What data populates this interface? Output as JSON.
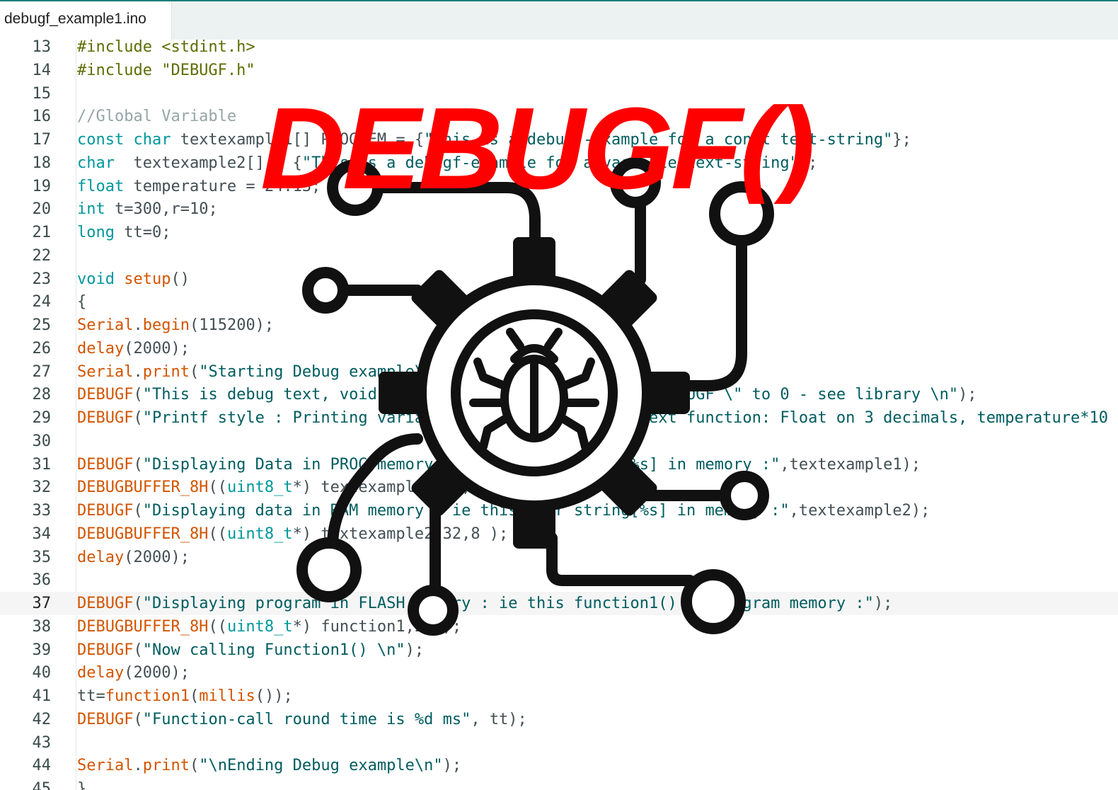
{
  "tab": {
    "filename": "debugf_example1.ino"
  },
  "editor": {
    "current_line": "37",
    "lines": [
      {
        "num": "13",
        "tokens": [
          {
            "t": "#include <stdint.h>",
            "c": "t-pre"
          }
        ]
      },
      {
        "num": "14",
        "tokens": [
          {
            "t": "#include \"DEBUGF.h\"",
            "c": "t-pre"
          }
        ]
      },
      {
        "num": "15",
        "tokens": []
      },
      {
        "num": "16",
        "tokens": [
          {
            "t": "//Global Variable",
            "c": "t-com"
          }
        ]
      },
      {
        "num": "17",
        "tokens": [
          {
            "t": "const char",
            "c": "t-kw"
          },
          {
            "t": " textexample1[] PROGMEM = {",
            "c": "t-p"
          },
          {
            "t": "\"This is a debugf-example for a const text-string\"",
            "c": "t-str"
          },
          {
            "t": "};",
            "c": "t-p"
          }
        ]
      },
      {
        "num": "18",
        "tokens": [
          {
            "t": "char",
            "c": "t-kw"
          },
          {
            "t": "  textexample2[] = {",
            "c": "t-p"
          },
          {
            "t": "\"This is a debugf-example for a variable text-string\"",
            "c": "t-str"
          },
          {
            "t": "};",
            "c": "t-p"
          }
        ]
      },
      {
        "num": "19",
        "tokens": [
          {
            "t": "float",
            "c": "t-kw"
          },
          {
            "t": " temperature = 24.13;",
            "c": "t-p"
          }
        ]
      },
      {
        "num": "20",
        "tokens": [
          {
            "t": "int",
            "c": "t-kw"
          },
          {
            "t": " t=300,r=10;",
            "c": "t-p"
          }
        ]
      },
      {
        "num": "21",
        "tokens": [
          {
            "t": "long",
            "c": "t-kw"
          },
          {
            "t": " tt=0;",
            "c": "t-p"
          }
        ]
      },
      {
        "num": "22",
        "tokens": []
      },
      {
        "num": "23",
        "tokens": [
          {
            "t": "void",
            "c": "t-kw"
          },
          {
            "t": " ",
            "c": "t-p"
          },
          {
            "t": "setup",
            "c": "t-fn"
          },
          {
            "t": "()",
            "c": "t-p"
          }
        ]
      },
      {
        "num": "24",
        "tokens": [
          {
            "t": "{",
            "c": "t-p"
          }
        ]
      },
      {
        "num": "25",
        "tokens": [
          {
            "t": "Serial",
            "c": "t-fn"
          },
          {
            "t": ".",
            "c": "t-p"
          },
          {
            "t": "begin",
            "c": "t-fn"
          },
          {
            "t": "(115200);",
            "c": "t-p"
          }
        ]
      },
      {
        "num": "26",
        "tokens": [
          {
            "t": "delay",
            "c": "t-fn"
          },
          {
            "t": "(2000);",
            "c": "t-p"
          }
        ]
      },
      {
        "num": "27",
        "tokens": [
          {
            "t": "Serial",
            "c": "t-fn"
          },
          {
            "t": ".",
            "c": "t-p"
          },
          {
            "t": "print",
            "c": "t-fn"
          },
          {
            "t": "(",
            "c": "t-p"
          },
          {
            "t": "\"Starting Debug example\\n\"",
            "c": "t-str"
          },
          {
            "t": ");",
            "c": "t-p"
          }
        ]
      },
      {
        "num": "28",
        "tokens": [
          {
            "t": "DEBUGF",
            "c": "t-fn"
          },
          {
            "t": "(",
            "c": "t-p"
          },
          {
            "t": "\"This is debug text, void-able by undefining \\\"#define DEBUGF \\\" to 0 - see library \\n\"",
            "c": "t-str"
          },
          {
            "t": ");",
            "c": "t-p"
          }
        ]
      },
      {
        "num": "29",
        "tokens": [
          {
            "t": "DEBUGF",
            "c": "t-fn"
          },
          {
            "t": "(",
            "c": "t-p"
          },
          {
            "t": "\"Printf style : Printing variables with ie %10.3f in text function: Float on 3 decimals, temperature*10",
            "c": "t-str"
          }
        ]
      },
      {
        "num": "30",
        "tokens": []
      },
      {
        "num": "31",
        "tokens": [
          {
            "t": "DEBUGF",
            "c": "t-fn"
          },
          {
            "t": "(",
            "c": "t-p"
          },
          {
            "t": "\"Displaying Data in PROG memory : const char string[%s] in memory :\"",
            "c": "t-str"
          },
          {
            "t": ",textexample1);",
            "c": "t-p"
          }
        ]
      },
      {
        "num": "32",
        "tokens": [
          {
            "t": "DEBUGBUFFER_8H",
            "c": "t-fn"
          },
          {
            "t": "((",
            "c": "t-p"
          },
          {
            "t": "uint8_t",
            "c": "t-kw"
          },
          {
            "t": "*) textexample1,32,8 );",
            "c": "t-p"
          }
        ]
      },
      {
        "num": "33",
        "tokens": [
          {
            "t": "DEBUGF",
            "c": "t-fn"
          },
          {
            "t": "(",
            "c": "t-p"
          },
          {
            "t": "\"Displaying data in RAM memory : ie this char string[%s] in memory :\"",
            "c": "t-str"
          },
          {
            "t": ",textexample2);",
            "c": "t-p"
          }
        ]
      },
      {
        "num": "34",
        "tokens": [
          {
            "t": "DEBUGBUFFER_8H",
            "c": "t-fn"
          },
          {
            "t": "((",
            "c": "t-p"
          },
          {
            "t": "uint8_t",
            "c": "t-kw"
          },
          {
            "t": "*) textexample2,32,8 );",
            "c": "t-p"
          }
        ]
      },
      {
        "num": "35",
        "tokens": [
          {
            "t": "delay",
            "c": "t-fn"
          },
          {
            "t": "(2000);",
            "c": "t-p"
          }
        ]
      },
      {
        "num": "36",
        "tokens": []
      },
      {
        "num": "37",
        "tokens": [
          {
            "t": "DEBUGF",
            "c": "t-fn"
          },
          {
            "t": "(",
            "c": "t-p"
          },
          {
            "t": "\"Displaying program in FLASH memory : ie this function1() in program memory :\"",
            "c": "t-str"
          },
          {
            "t": ");",
            "c": "t-p"
          }
        ]
      },
      {
        "num": "38",
        "tokens": [
          {
            "t": "DEBUGBUFFER_8H",
            "c": "t-fn"
          },
          {
            "t": "((",
            "c": "t-p"
          },
          {
            "t": "uint8_t",
            "c": "t-kw"
          },
          {
            "t": "*) function1,24 );",
            "c": "t-p"
          }
        ]
      },
      {
        "num": "39",
        "tokens": [
          {
            "t": "DEBUGF",
            "c": "t-fn"
          },
          {
            "t": "(",
            "c": "t-p"
          },
          {
            "t": "\"Now calling Function1() \\n\"",
            "c": "t-str"
          },
          {
            "t": ");",
            "c": "t-p"
          }
        ]
      },
      {
        "num": "40",
        "tokens": [
          {
            "t": "delay",
            "c": "t-fn"
          },
          {
            "t": "(2000);",
            "c": "t-p"
          }
        ]
      },
      {
        "num": "41",
        "tokens": [
          {
            "t": "tt=",
            "c": "t-p"
          },
          {
            "t": "function1",
            "c": "t-fn"
          },
          {
            "t": "(",
            "c": "t-p"
          },
          {
            "t": "millis",
            "c": "t-fn"
          },
          {
            "t": "());",
            "c": "t-p"
          }
        ]
      },
      {
        "num": "42",
        "tokens": [
          {
            "t": "DEBUGF",
            "c": "t-fn"
          },
          {
            "t": "(",
            "c": "t-p"
          },
          {
            "t": "\"Function-call round time is %d ms\"",
            "c": "t-str"
          },
          {
            "t": ", tt);",
            "c": "t-p"
          }
        ]
      },
      {
        "num": "43",
        "tokens": []
      },
      {
        "num": "44",
        "tokens": [
          {
            "t": "Serial",
            "c": "t-fn"
          },
          {
            "t": ".",
            "c": "t-p"
          },
          {
            "t": "print",
            "c": "t-fn"
          },
          {
            "t": "(",
            "c": "t-p"
          },
          {
            "t": "\"\\nEnding Debug example\\n\"",
            "c": "t-str"
          },
          {
            "t": ");",
            "c": "t-p"
          }
        ]
      },
      {
        "num": "45",
        "tokens": [
          {
            "t": "}",
            "c": "t-p"
          }
        ]
      }
    ]
  },
  "overlay": {
    "title": "DEBUGF()",
    "title_color": "#ff0000",
    "icon": "bug-gear-circuit-icon",
    "icon_color": "#111111"
  }
}
